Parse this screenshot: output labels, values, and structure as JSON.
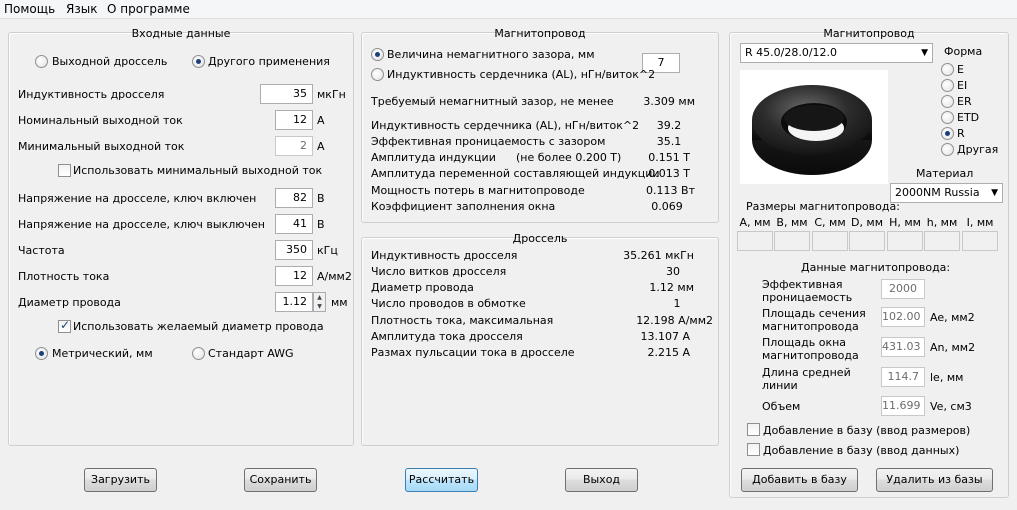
{
  "menu": {
    "help": "Помощь",
    "language": "Язык",
    "about": "О программе"
  },
  "input": {
    "title": "Входные данные",
    "radio_output": "Выходной дроссель",
    "radio_other": "Другого применения",
    "inductance_label": "Индуктивность дросселя",
    "inductance_value": "35",
    "inductance_unit": "мкГн",
    "nom_current_label": "Номинальный выходной ток",
    "nom_current_value": "12",
    "nom_current_unit": "А",
    "min_current_label": "Минимальный выходной ток",
    "min_current_value": "2",
    "min_current_unit": "А",
    "use_min_current": "Использовать минимальный выходной ток",
    "v_on_label": "Напряжение на дросселе, ключ включен",
    "v_on_value": "82",
    "v_on_unit": "В",
    "v_off_label": "Напряжение на дросселе, ключ выключен",
    "v_off_value": "41",
    "v_off_unit": "В",
    "freq_label": "Частота",
    "freq_value": "350",
    "freq_unit": "кГц",
    "density_label": "Плотность тока",
    "density_value": "12",
    "density_unit": "А/мм2",
    "wire_label": "Диаметр провода",
    "wire_value": "1.12",
    "wire_unit": "мм",
    "use_wire": "Использовать желаемый диаметр провода",
    "metric": "Метрический, мм",
    "awg": "Стандарт AWG"
  },
  "core_calc": {
    "title": "Магнитопровод",
    "radio_gap": "Величина немагнитного зазора, мм",
    "gap_value": "7",
    "radio_al": "Индуктивность сердечника (AL), нГн/виток^2",
    "rows1": [
      {
        "label": "Требуемый немагнитный зазор, не менее",
        "value": "3.309 мм"
      }
    ],
    "rows2": [
      {
        "label": "Индуктивность сердечника (AL), нГн/виток^2",
        "value": "39.2"
      },
      {
        "label": "Эффективная проницаемость с зазором",
        "value": "35.1"
      },
      {
        "label": "Амплитуда индукции",
        "note": "(не более 0.200 Т)",
        "value": "0.151 Т"
      },
      {
        "label": "Амплитуда переменной составляющей индукции",
        "value": "0.013 Т"
      },
      {
        "label": "Мощность потерь в магнитопроводе",
        "value": "0.113 Вт"
      },
      {
        "label": "Коэффициент заполнения окна",
        "value": "0.069"
      }
    ]
  },
  "choke": {
    "title": "Дроссель",
    "rows": [
      {
        "label": "Индуктивность дросселя",
        "value": "35.261 мкГн"
      },
      {
        "label": "Число витков дросселя",
        "value": "30"
      },
      {
        "label": "Диаметр провода",
        "value": "1.12 мм"
      },
      {
        "label": "Число проводов в обмотке",
        "value": "1"
      },
      {
        "label": "Плотность тока, максимальная",
        "value": "12.198 А/мм2"
      },
      {
        "label": "Амплитуда тока дросселя",
        "value": "13.107 А"
      },
      {
        "label": "Размах пульсации тока в дросселе",
        "value": "2.215 А"
      }
    ]
  },
  "core_db": {
    "title": "Магнитопровод",
    "core_select": "R 45.0/28.0/12.0",
    "shape_label": "Форма",
    "shapes": [
      "E",
      "EI",
      "ER",
      "ETD",
      "R",
      "Другая"
    ],
    "material_label": "Материал",
    "material_select": "2000NM Russia",
    "dims_label": "Размеры магнитопровода:",
    "dims": [
      "A, мм",
      "B, мм",
      "C, мм",
      "D, мм",
      "H, мм",
      "h, мм",
      "I, мм"
    ],
    "data_label": "Данные магнитопровода:",
    "perm_label1": "Эффективная",
    "perm_label2": "проницаемость",
    "perm_value": "2000",
    "ae_label1": "Площадь сечения",
    "ae_label2": "магнитопровода",
    "ae_value": "102.00",
    "ae_unit": "Ae, мм2",
    "an_label1": "Площадь окна",
    "an_label2": "магнитопровода",
    "an_value": "431.03",
    "an_unit": "An, мм2",
    "le_label1": "Длина средней",
    "le_label2": "линии",
    "le_value": "114.7",
    "le_unit": "le, мм",
    "ve_label": "Объем",
    "ve_value": "11.699",
    "ve_unit": "Ve, см3",
    "add_dims": "Добавление в базу (ввод размеров)",
    "add_data": "Добавление в базу (ввод данных)",
    "add_btn": "Добавить в базу",
    "del_btn": "Удалить из базы"
  },
  "buttons": {
    "load": "Загрузить",
    "save": "Сохранить",
    "calc": "Рассчитать",
    "exit": "Выход"
  }
}
